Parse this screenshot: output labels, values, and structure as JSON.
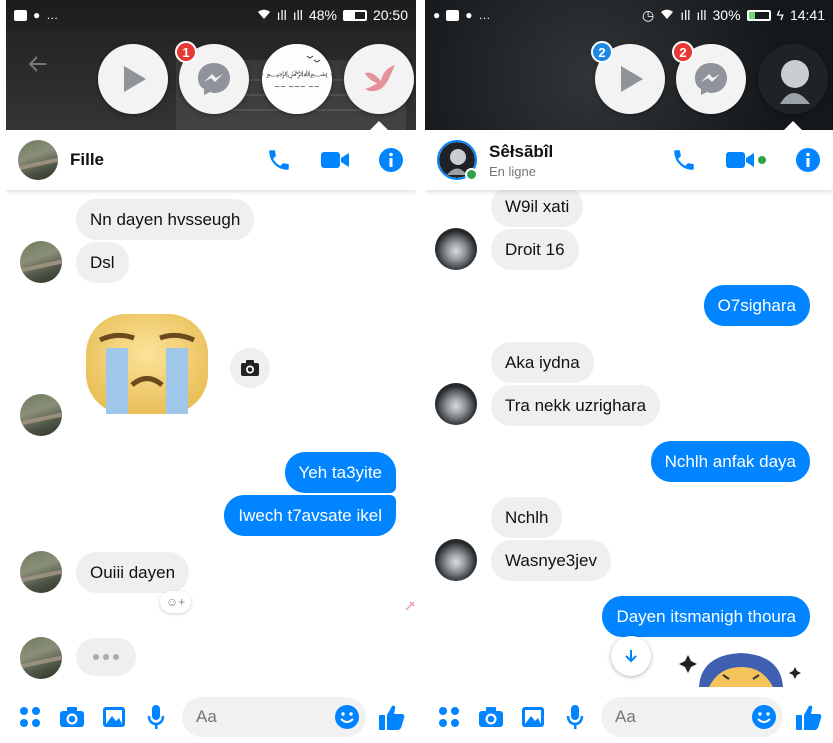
{
  "left": {
    "status": {
      "carrier1": "ıll",
      "carrier2": "ıll",
      "battery": "48%",
      "time": "20:50",
      "battery_level": 0.48
    },
    "chatheads": {
      "messenger_badge": "1",
      "calligraphy_text": "بسم الله"
    },
    "header": {
      "name": "Fille"
    },
    "messages": [
      {
        "text": "Nn dayen  hvsseugh"
      },
      {
        "text": "Dsl"
      },
      {
        "text": "Yeh ta3yite"
      },
      {
        "text": "Iwech t7avsate ikel"
      },
      {
        "text": "Ouiii dayen"
      }
    ],
    "reaction_add": "☺+",
    "composer": {
      "placeholder": "Aa"
    }
  },
  "right": {
    "status": {
      "carrier1": "ıll",
      "carrier2": "ıll",
      "battery": "30%",
      "time": "14:41",
      "battery_level": 0.3
    },
    "chatheads": {
      "play_badge": "2",
      "messenger_badge": "2"
    },
    "header": {
      "name": "Sêłsãbîl",
      "status": "En ligne"
    },
    "messages": [
      {
        "text": "W9il xati"
      },
      {
        "text": "Droit 16"
      },
      {
        "text": "O7sighara"
      },
      {
        "text": "Aka iydna"
      },
      {
        "text": "Tra nekk uzrighara"
      },
      {
        "text": "Nchlh anfak daya"
      },
      {
        "text": "Nchlh"
      },
      {
        "text": "Wasnye3jev"
      },
      {
        "text": "Dayen itsmanigh thoura"
      }
    ],
    "composer": {
      "placeholder": "Aa"
    }
  },
  "colors": {
    "accent": "#0084ff",
    "incoming": "#efefef",
    "badge_red": "#e53935",
    "badge_blue": "#1e88e5",
    "online": "#31a24c"
  }
}
